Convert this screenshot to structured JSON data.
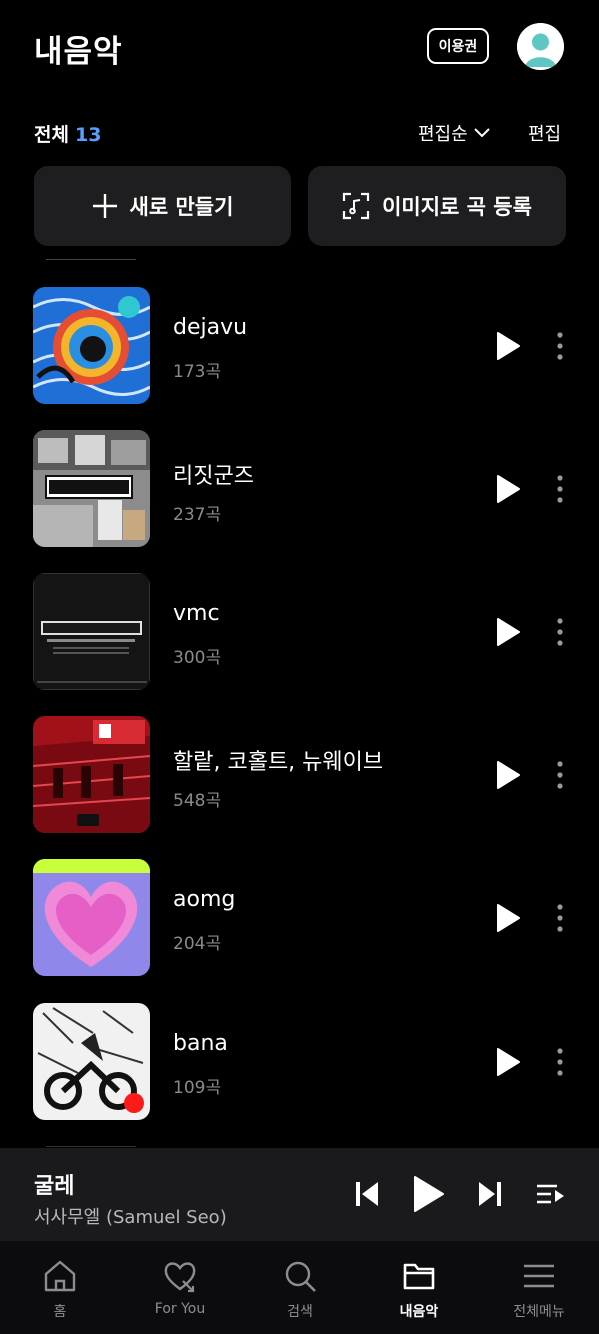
{
  "header": {
    "title": "내음악",
    "pass_label": "이용권"
  },
  "filter": {
    "total_label": "전체",
    "total_count": "13",
    "sort_label": "편집순",
    "edit_label": "편집"
  },
  "actions": {
    "new_label": "새로 만들기",
    "image_label": "이미지로 곡 등록"
  },
  "playlists": [
    {
      "name": "dejavu",
      "count": "173곡"
    },
    {
      "name": "리짓군즈",
      "count": "237곡"
    },
    {
      "name": "vmc",
      "count": "300곡"
    },
    {
      "name": "할랕, 코홀트, 뉴웨이브",
      "count": "548곡"
    },
    {
      "name": "aomg",
      "count": "204곡"
    },
    {
      "name": "bana",
      "count": "109곡"
    }
  ],
  "now_playing": {
    "title": "굴레",
    "artist": "서사무엘 (Samuel Seo)"
  },
  "nav": [
    {
      "label": "홈",
      "icon": "home-icon"
    },
    {
      "label": "For You",
      "icon": "heart-icon"
    },
    {
      "label": "검색",
      "icon": "search-icon"
    },
    {
      "label": "내음악",
      "icon": "folder-icon"
    },
    {
      "label": "전체메뉴",
      "icon": "menu-icon"
    }
  ],
  "colors": {
    "accent": "#5aa0ff",
    "background": "#000000",
    "card": "#1e1e20",
    "player": "#1a1a1c"
  }
}
